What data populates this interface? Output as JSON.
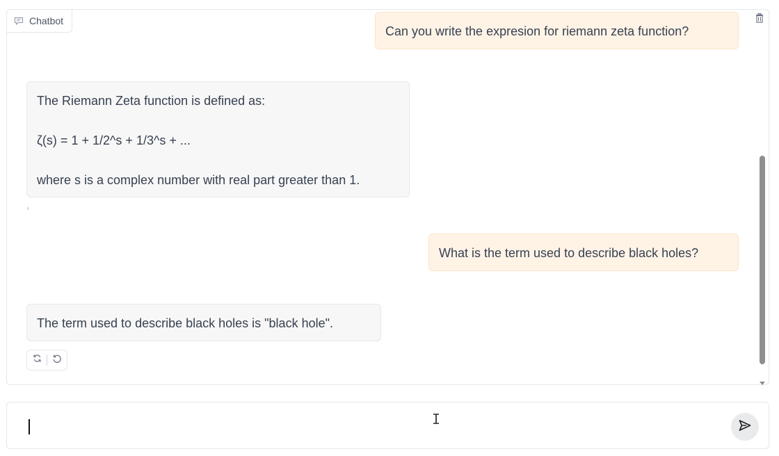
{
  "chatbot": {
    "label": "Chatbot",
    "messages": [
      {
        "role": "user",
        "text": "Can you write the expresion for riemann zeta function?"
      },
      {
        "role": "bot",
        "lines": [
          "The Riemann Zeta function is defined as:",
          "ζ(s) = 1 + 1/2^s + 1/3^s + ...",
          "where s is a complex number with real part greater than 1."
        ]
      },
      {
        "role": "user",
        "text": "What is the term used to describe black holes?"
      },
      {
        "role": "bot",
        "text": "The term used to describe black holes is \"black hole\"."
      }
    ],
    "actions": [
      "retry-icon",
      "undo-icon"
    ]
  },
  "input": {
    "value": "",
    "placeholder": ""
  },
  "icons": {
    "chatbot": "chat-bubble-icon",
    "clear": "trash-icon",
    "send": "send-icon"
  },
  "colors": {
    "user_bubble": "#fff3e6",
    "user_border": "#fde4c8",
    "bot_bubble": "#f7f7f7",
    "border": "#e5e7eb",
    "send_button": "#e9eaec"
  }
}
